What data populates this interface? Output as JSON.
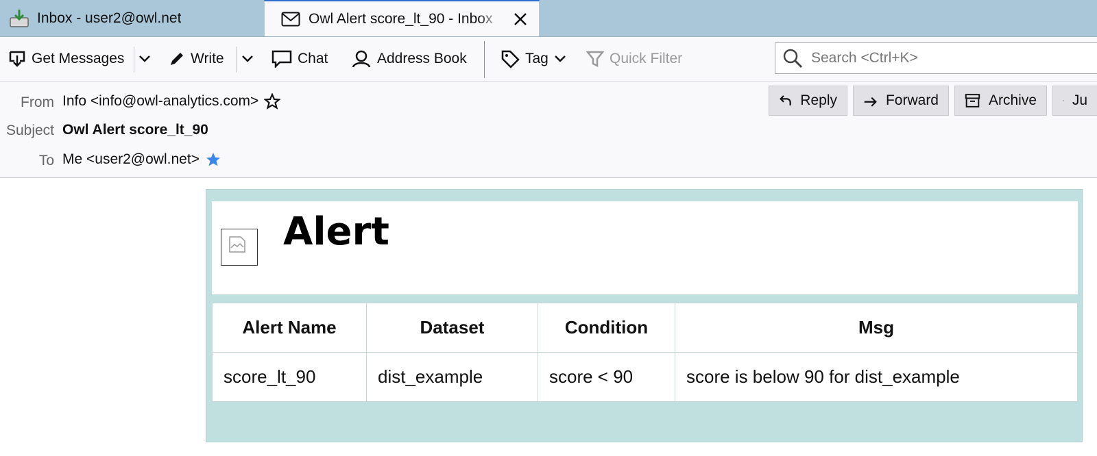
{
  "tabs": [
    {
      "label": "Inbox - user2@owl.net",
      "icon": "inbox-download-icon"
    },
    {
      "label": "Owl Alert score_lt_90 - Inbox",
      "icon": "envelope-icon",
      "active": true
    }
  ],
  "toolbar": {
    "get_messages": "Get Messages",
    "write": "Write",
    "chat": "Chat",
    "address_book": "Address Book",
    "tag": "Tag",
    "quick_filter": "Quick Filter",
    "search_placeholder": "Search <Ctrl+K>"
  },
  "header": {
    "from_label": "From",
    "from_value": "Info <info@owl-analytics.com>",
    "subject_label": "Subject",
    "subject_value": "Owl Alert score_lt_90",
    "to_label": "To",
    "to_value": "Me <user2@owl.net>",
    "buttons": {
      "reply": "Reply",
      "forward": "Forward",
      "archive": "Archive",
      "junk": "Ju"
    }
  },
  "body": {
    "title": "Alert",
    "table": {
      "headers": [
        "Alert Name",
        "Dataset",
        "Condition",
        "Msg"
      ],
      "rows": [
        [
          "score_lt_90",
          "dist_example",
          "score < 90",
          "score is below 90 for dist_example"
        ]
      ]
    }
  },
  "colors": {
    "tabbar": "#a9c7d8",
    "accent": "#2a6fd0",
    "mail_bg": "#c0e0e0",
    "star_blue": "#3a86ea"
  }
}
